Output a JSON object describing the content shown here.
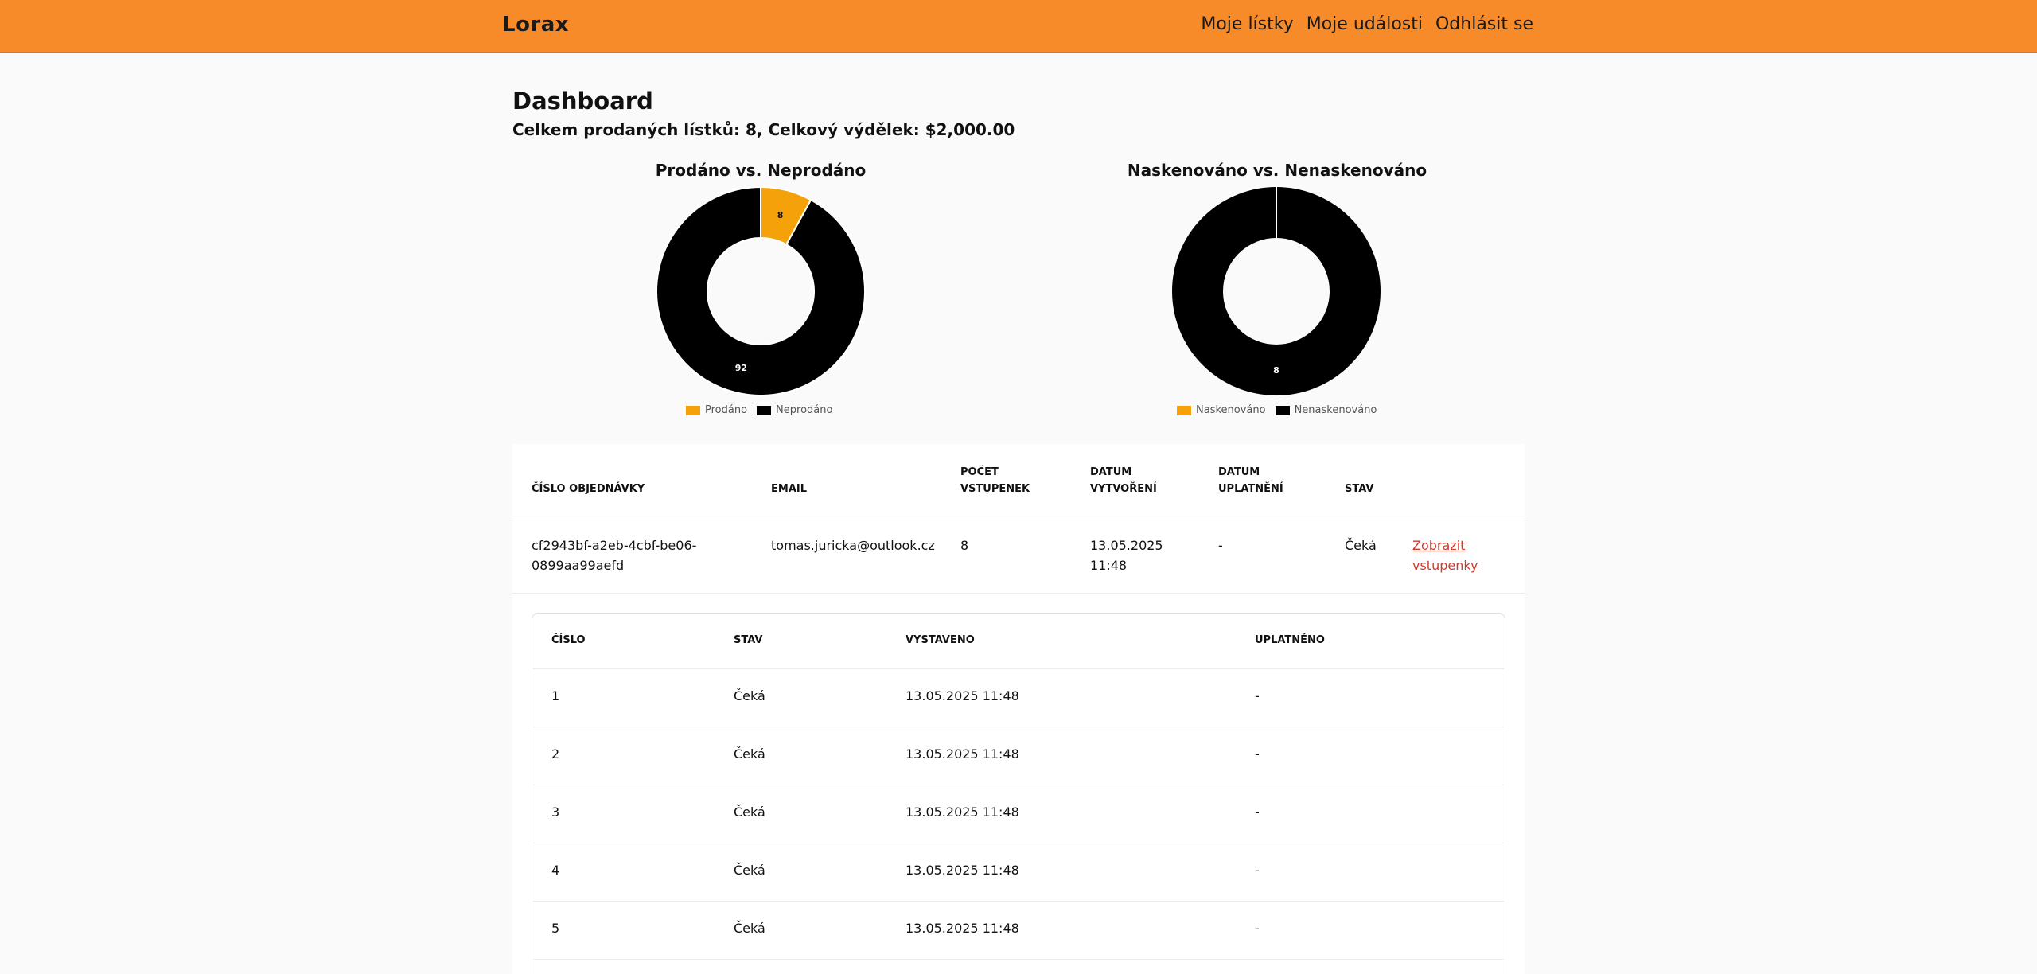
{
  "header": {
    "logo": "Lorax",
    "nav": [
      "Moje lístky",
      "Moje události",
      "Odhlásit se"
    ]
  },
  "page": {
    "title": "Dashboard",
    "summary": "Celkem prodaných lístků: 8, Celkový výdělek: $2,000.00"
  },
  "colors": {
    "brand": "#f78a29",
    "primary_series": "#f5a10a",
    "secondary_series": "#000000",
    "link": "#d23a2b"
  },
  "chart_data": [
    {
      "type": "pie",
      "title": "Prodáno vs. Neprodáno",
      "categories": [
        "Prodáno",
        "Neprodáno"
      ],
      "values": [
        8,
        92
      ],
      "colors": [
        "#f5a10a",
        "#000000"
      ],
      "legend": "bottom"
    },
    {
      "type": "pie",
      "title": "Naskenováno vs. Nenaskenováno",
      "categories": [
        "Naskenováno",
        "Nenaskenováno"
      ],
      "values": [
        0,
        8
      ],
      "colors": [
        "#f5a10a",
        "#000000"
      ],
      "legend": "bottom"
    }
  ],
  "orders": {
    "headers": [
      "ČÍSLO OBJEDNÁVKY",
      "EMAIL",
      "POČET VSTUPENEK",
      "DATUM VYTVOŘENÍ",
      "DATUM UPLATNĚNÍ",
      "STAV"
    ],
    "rows": [
      {
        "order_id": "cf2943bf-a2eb-4cbf-be06-0899aa99aefd",
        "email": "tomas.juricka@outlook.cz",
        "count": "8",
        "created": "13.05.2025 11:48",
        "redeemed": "-",
        "status": "Čeká",
        "action": "Zobrazit vstupenky"
      }
    ]
  },
  "tickets": {
    "headers": [
      "ČÍSLO",
      "STAV",
      "VYSTAVENO",
      "UPLATNĚNO"
    ],
    "rows": [
      {
        "number": "1",
        "status": "Čeká",
        "issued": "13.05.2025 11:48",
        "redeemed": "-"
      },
      {
        "number": "2",
        "status": "Čeká",
        "issued": "13.05.2025 11:48",
        "redeemed": "-"
      },
      {
        "number": "3",
        "status": "Čeká",
        "issued": "13.05.2025 11:48",
        "redeemed": "-"
      },
      {
        "number": "4",
        "status": "Čeká",
        "issued": "13.05.2025 11:48",
        "redeemed": "-"
      },
      {
        "number": "5",
        "status": "Čeká",
        "issued": "13.05.2025 11:48",
        "redeemed": "-"
      }
    ]
  }
}
